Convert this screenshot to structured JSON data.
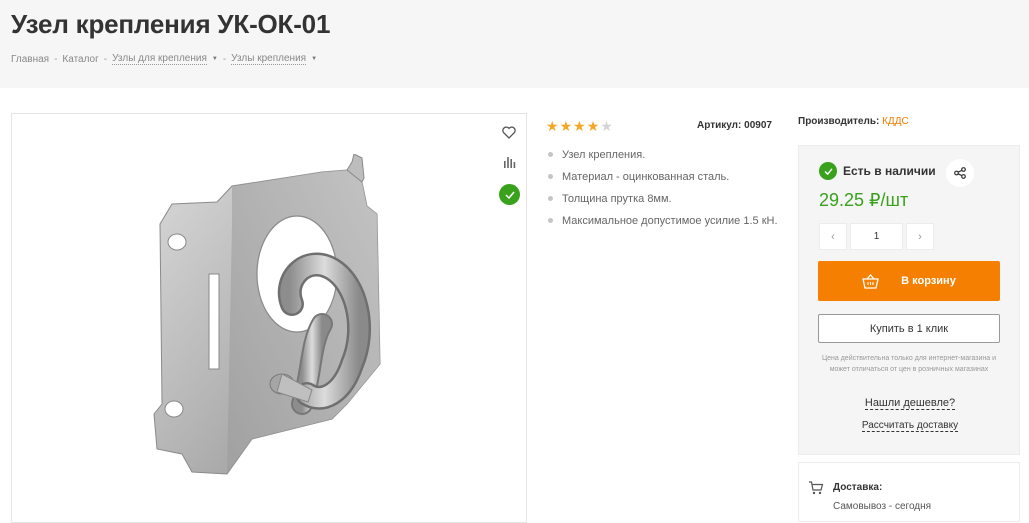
{
  "title": "Узел крепления УК-ОК-01",
  "breadcrumb": [
    {
      "label": "Главная"
    },
    {
      "label": "Каталог"
    },
    {
      "label": "Узлы для крепления"
    },
    {
      "label": "Узлы крепления"
    }
  ],
  "product": {
    "rating_value": 4,
    "rating_max": 5,
    "article_label": "Артикул:",
    "article_value": "00907",
    "features": [
      "Узел крепления.",
      "Материал - оцинкованная сталь.",
      "Толщина прутка 8мм.",
      "Максимальное допустимое усилие 1.5 кН."
    ]
  },
  "manufacturer": {
    "label": "Производитель:",
    "value": "КДДС"
  },
  "buy": {
    "stock_text": "Есть в наличии",
    "price": "29.25 ₽/шт",
    "qty_minus": "‹",
    "qty_value": "1",
    "qty_plus": "›",
    "cart_label": "В корзину",
    "one_click_label": "Купить в 1 клик",
    "note": "Цена действительна только для интернет-магазина и может отличаться от цен в розничных магазинах",
    "cheaper_label": "Нашли дешевле?",
    "delivery_calc_label": "Рассчитать доставку"
  },
  "delivery": {
    "title": "Доставка:",
    "line1": "Самовывоз - сегодня"
  },
  "colors": {
    "accent_orange": "#f57f00",
    "green": "#3aa11c",
    "star": "#f5a623"
  },
  "icons": {
    "wishlist": "heart-icon",
    "compare": "bar-chart-icon",
    "available": "check-icon",
    "share": "share-icon",
    "cart": "basket-icon",
    "delivery": "cart-icon"
  }
}
